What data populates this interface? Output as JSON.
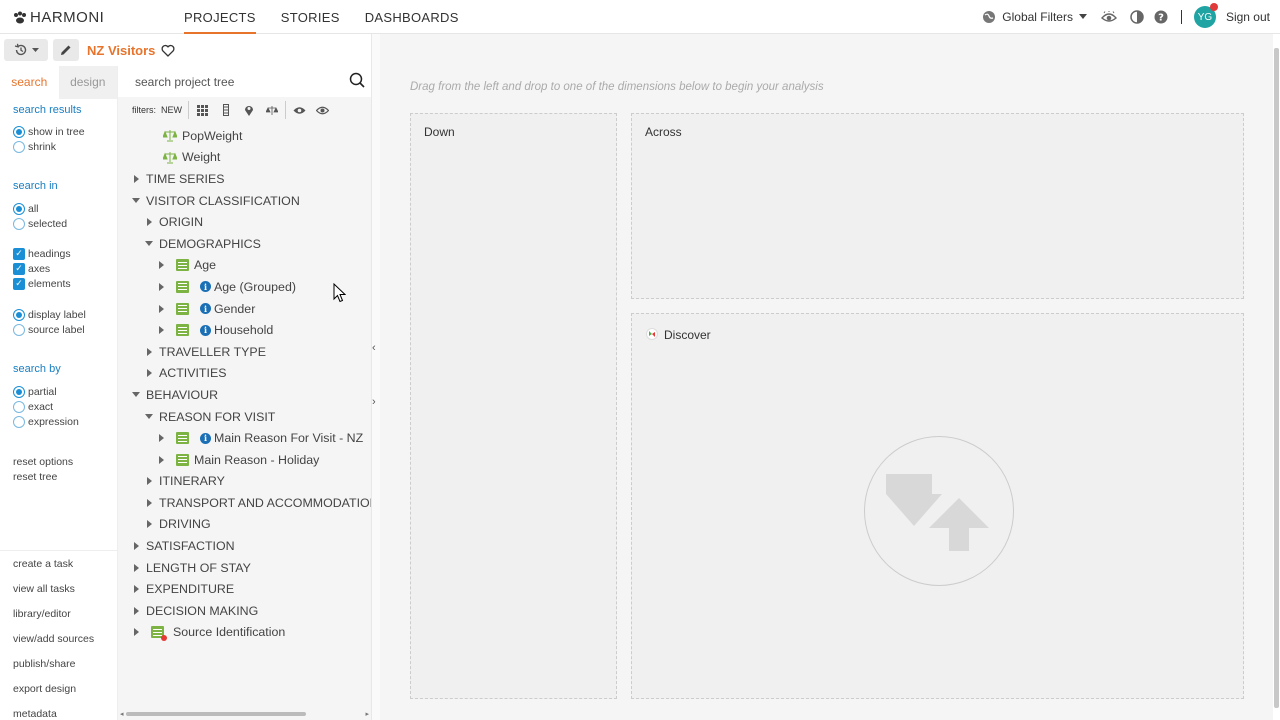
{
  "app": {
    "logo_text": "HARMONI"
  },
  "nav": {
    "items": [
      {
        "label": "PROJECTS",
        "active": true
      },
      {
        "label": "STORIES",
        "active": false
      },
      {
        "label": "DASHBOARDS",
        "active": false
      }
    ]
  },
  "topright": {
    "global_filters_label": "Global Filters",
    "avatar_initials": "YG",
    "sign_out_label": "Sign out"
  },
  "project": {
    "name": "NZ Visitors"
  },
  "left_tabs": {
    "search_label": "search",
    "design_label": "design"
  },
  "options": {
    "search_results_title": "search results",
    "show_in_tree": "show in tree",
    "shrink": "shrink",
    "search_in_title": "search in",
    "all": "all",
    "selected": "selected",
    "headings": "headings",
    "axes": "axes",
    "elements": "elements",
    "display_label": "display label",
    "source_label": "source label",
    "search_by_title": "search by",
    "partial": "partial",
    "exact": "exact",
    "expression": "expression",
    "reset_options": "reset options",
    "reset_tree": "reset tree"
  },
  "bottom_links": [
    "create a task",
    "view all tasks",
    "library/editor",
    "view/add sources",
    "publish/share",
    "export design",
    "metadata"
  ],
  "tree_search": {
    "placeholder": "search project tree",
    "filters_label": "filters:",
    "new_label": "NEW"
  },
  "tree": [
    {
      "label": "PopWeight",
      "level": 1,
      "kind": "weight"
    },
    {
      "label": "Weight",
      "level": 1,
      "kind": "weight"
    },
    {
      "label": "TIME SERIES",
      "level": 0,
      "kind": "folder",
      "expanded": false
    },
    {
      "label": "VISITOR CLASSIFICATION",
      "level": 0,
      "kind": "folder",
      "expanded": true
    },
    {
      "label": "ORIGIN",
      "level": 1,
      "kind": "folder",
      "expanded": false
    },
    {
      "label": "DEMOGRAPHICS",
      "level": 1,
      "kind": "folder",
      "expanded": true
    },
    {
      "label": "Age",
      "level": 2,
      "kind": "variable",
      "info": false
    },
    {
      "label": "Age (Grouped)",
      "level": 2,
      "kind": "variable",
      "info": true
    },
    {
      "label": "Gender",
      "level": 2,
      "kind": "variable",
      "info": true
    },
    {
      "label": "Household",
      "level": 2,
      "kind": "variable",
      "info": true
    },
    {
      "label": "TRAVELLER TYPE",
      "level": 1,
      "kind": "folder",
      "expanded": false
    },
    {
      "label": "ACTIVITIES",
      "level": 1,
      "kind": "folder",
      "expanded": false
    },
    {
      "label": "BEHAVIOUR",
      "level": 0,
      "kind": "folder",
      "expanded": true
    },
    {
      "label": "REASON FOR VISIT",
      "level": 1,
      "kind": "folder",
      "expanded": true
    },
    {
      "label": "Main Reason For Visit - NZ",
      "level": 2,
      "kind": "variable",
      "info": true
    },
    {
      "label": "Main Reason - Holiday",
      "level": 2,
      "kind": "variable",
      "info": false
    },
    {
      "label": "ITINERARY",
      "level": 1,
      "kind": "folder",
      "expanded": false
    },
    {
      "label": "TRANSPORT AND ACCOMMODATION",
      "level": 1,
      "kind": "folder",
      "expanded": false
    },
    {
      "label": "DRIVING",
      "level": 1,
      "kind": "folder",
      "expanded": false
    },
    {
      "label": "SATISFACTION",
      "level": 0,
      "kind": "folder",
      "expanded": false
    },
    {
      "label": "LENGTH OF STAY",
      "level": 0,
      "kind": "folder",
      "expanded": false
    },
    {
      "label": "EXPENDITURE",
      "level": 0,
      "kind": "folder",
      "expanded": false
    },
    {
      "label": "DECISION MAKING",
      "level": 0,
      "kind": "folder",
      "expanded": false
    },
    {
      "label": "Source Identification",
      "level": 0,
      "kind": "source",
      "expanded": false
    }
  ],
  "canvas": {
    "hint": "Drag from the left and drop to one of the dimensions below to begin your analysis",
    "down_label": "Down",
    "across_label": "Across",
    "discover_label": "Discover"
  },
  "colors": {
    "accent": "#e8742c",
    "link_blue": "#1a7fc1",
    "variable_green": "#7cb342",
    "avatar_teal": "#1fa3a3"
  }
}
